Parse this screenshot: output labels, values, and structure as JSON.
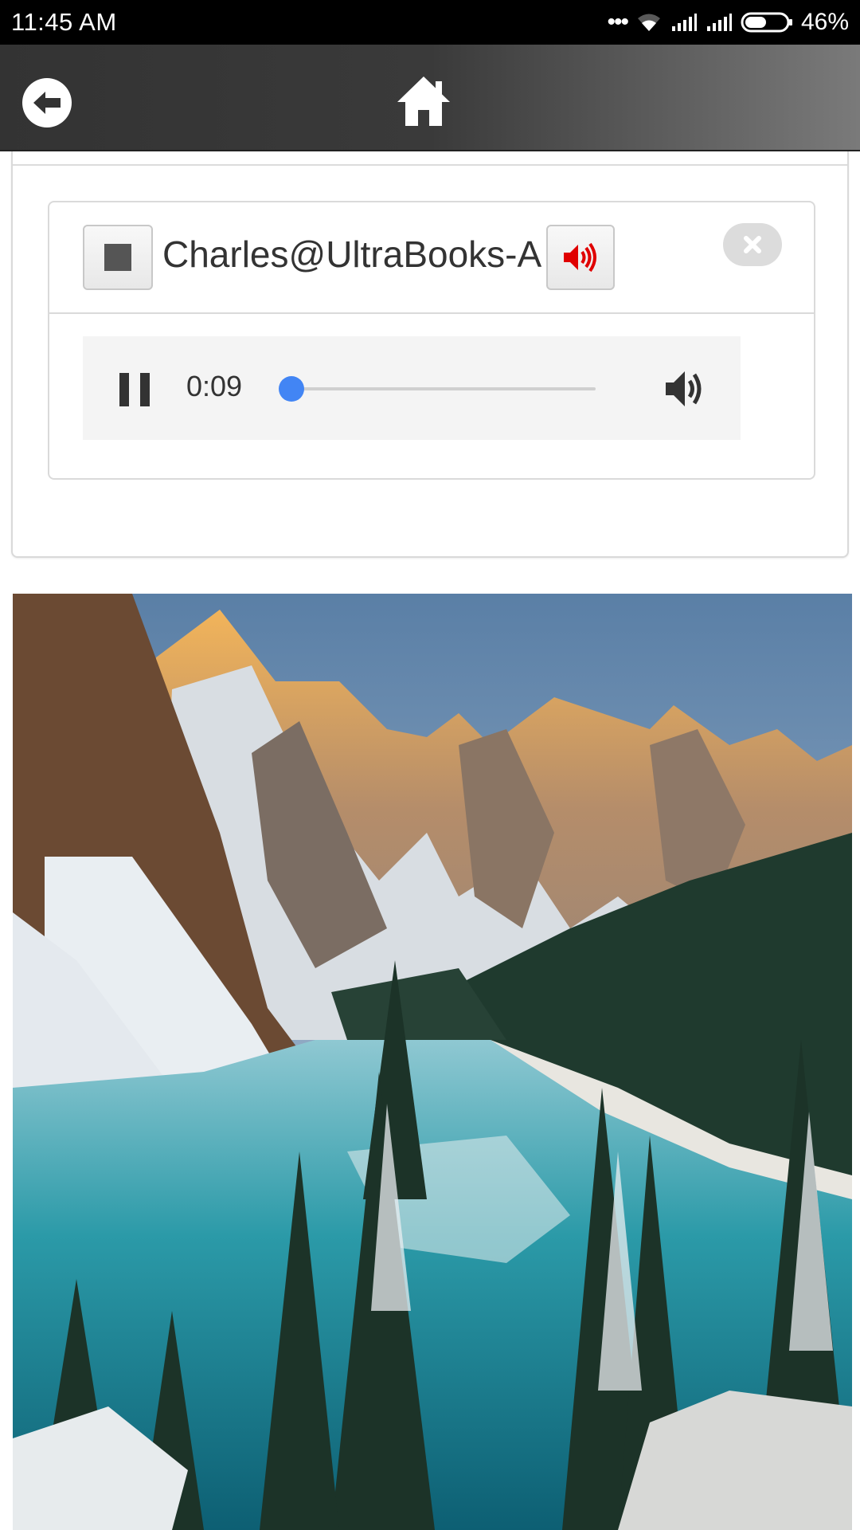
{
  "status_bar": {
    "time": "11:45 AM",
    "battery_percent": "46%",
    "signal_dots": "•••",
    "icons": [
      "more-dots-icon",
      "wifi-icon",
      "signal-icon",
      "signal-icon",
      "battery-icon"
    ]
  },
  "toolbar": {
    "back_icon": "arrow-left-icon",
    "home_icon": "home-icon"
  },
  "call_card": {
    "user_name": "Charles@UltraBooks-A",
    "stop_icon": "stop-icon",
    "speaker_icon": "speaker-volume-icon",
    "close_icon": "close-icon",
    "accent_color": "#e00000"
  },
  "audio_player": {
    "current_time": "0:09",
    "progress": 0.02,
    "pause_icon": "pause-icon",
    "volume_icon": "volume-icon",
    "thumb_color": "#4285f4"
  },
  "media": {
    "image_subject": "mountain-lake-landscape"
  }
}
